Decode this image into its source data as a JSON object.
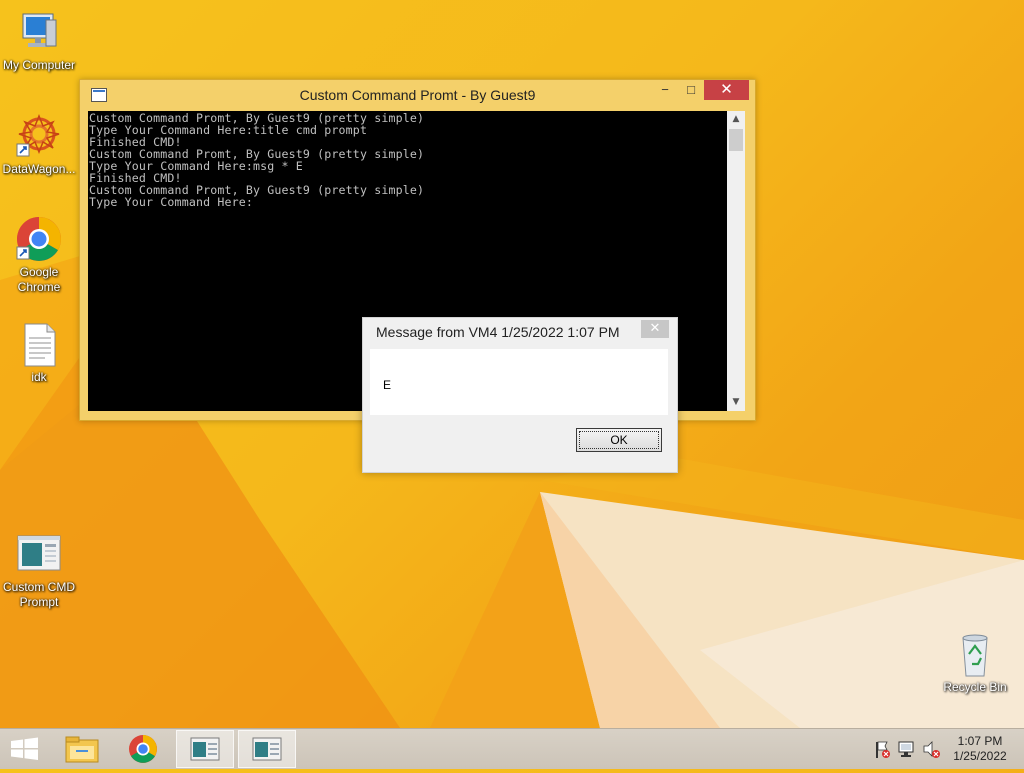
{
  "desktop": {
    "icons": [
      {
        "label": "My Computer",
        "icon": "computer-icon"
      },
      {
        "label": "DataWagon...",
        "icon": "datawagon-icon"
      },
      {
        "label": "Google Chrome",
        "icon": "chrome-icon"
      },
      {
        "label": "idk",
        "icon": "text-file-icon"
      },
      {
        "label": "Custom CMD Prompt",
        "icon": "app-window-icon"
      },
      {
        "label": "Recycle Bin",
        "icon": "recycle-bin-icon"
      }
    ]
  },
  "cmd_window": {
    "title": "Custom Command Promt - By Guest9",
    "minimize": "−",
    "maximize": "□",
    "close": "✕",
    "lines": [
      "Custom Command Promt, By Guest9 (pretty simple)",
      "Type Your Command Here:title cmd prompt",
      "Finished CMD!",
      "Custom Command Promt, By Guest9 (pretty simple)",
      "Type Your Command Here:msg * E",
      "Finished CMD!",
      "Custom Command Promt, By Guest9 (pretty simple)",
      "Type Your Command Here:"
    ]
  },
  "message_box": {
    "title": "Message from VM4 1/25/2022 1:07 PM",
    "close": "✕",
    "text": "E",
    "ok_label": "OK"
  },
  "taskbar": {
    "items": [
      "start-icon",
      "file-explorer-icon",
      "chrome-icon",
      "custom-cmd-icon",
      "custom-cmd-icon"
    ],
    "tray_icons": [
      "action-center-flag-icon",
      "network-icon",
      "volume-muted-icon"
    ],
    "time": "1:07 PM",
    "date": "1/25/2022"
  },
  "colors": {
    "wallpaper": "#f5b81b",
    "close_red": "#c74145",
    "console_bg": "#000000",
    "console_text": "#c0c0c0"
  }
}
